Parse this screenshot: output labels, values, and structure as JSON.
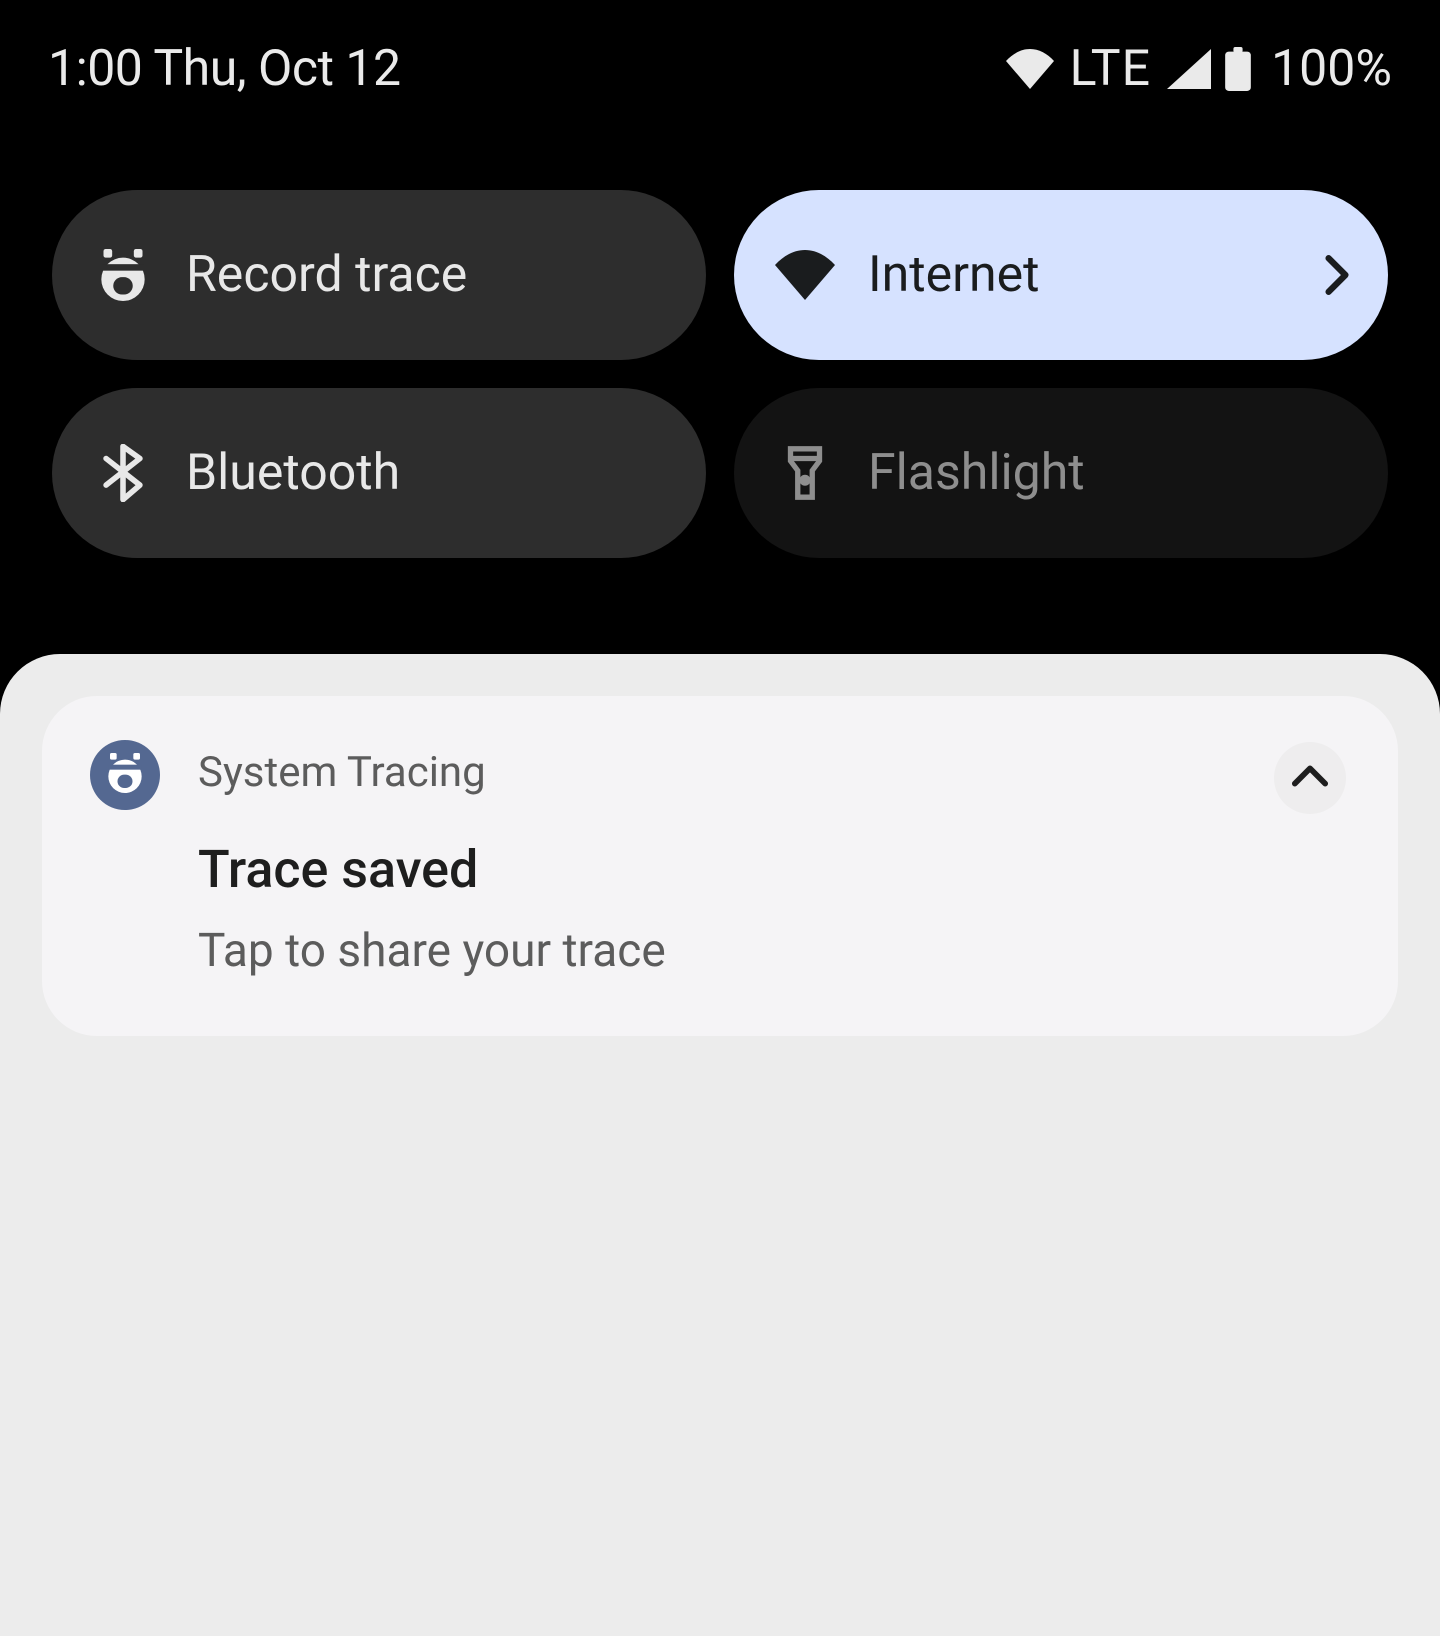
{
  "statusbar": {
    "time_date": "1:00 Thu, Oct 12",
    "network_label": "LTE",
    "battery_percent": "100%"
  },
  "quick_settings": {
    "tiles": [
      {
        "label": "Record trace",
        "icon": "bug-icon",
        "state": "off",
        "has_chevron": false
      },
      {
        "label": "Internet",
        "icon": "wifi-icon",
        "state": "on",
        "has_chevron": true
      },
      {
        "label": "Bluetooth",
        "icon": "bluetooth-icon",
        "state": "off",
        "has_chevron": false
      },
      {
        "label": "Flashlight",
        "icon": "flashlight-icon",
        "state": "dim",
        "has_chevron": false
      }
    ]
  },
  "notification": {
    "app_name": "System Tracing",
    "title": "Trace saved",
    "text": "Tap to share your trace",
    "icon": "bug-icon"
  }
}
